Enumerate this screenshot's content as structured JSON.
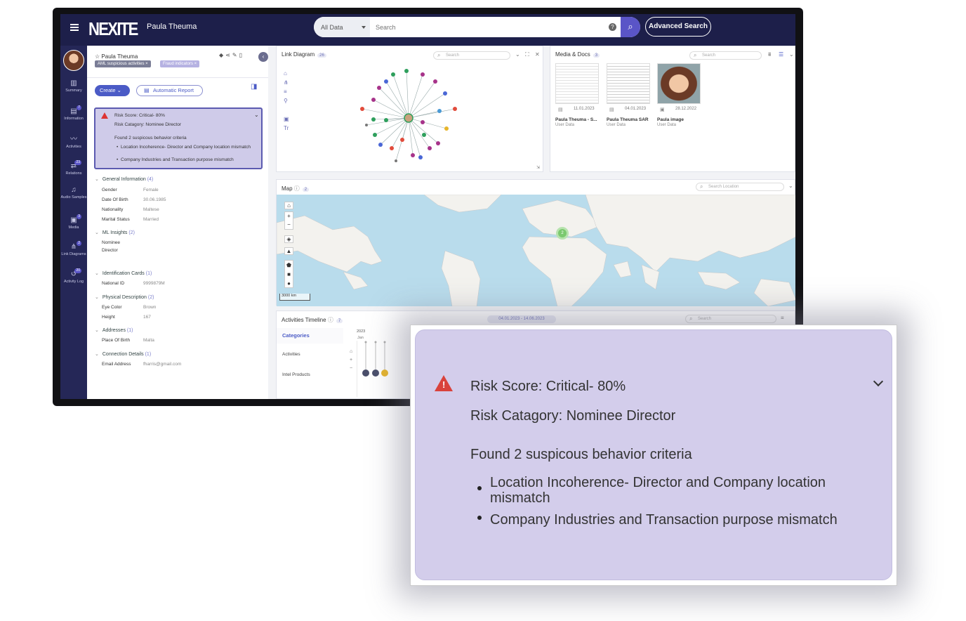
{
  "app": {
    "brand": "NEXITE",
    "user_name": "Paula Theuma"
  },
  "search": {
    "scope": "All Data",
    "placeholder": "Search",
    "advanced_label": "Advanced Search"
  },
  "nav": [
    {
      "label": "Summary",
      "icon": "chart-icon",
      "badge": ""
    },
    {
      "label": "Information",
      "icon": "info-icon",
      "badge": "7"
    },
    {
      "label": "Activities",
      "icon": "activity-icon",
      "badge": ""
    },
    {
      "label": "Relations",
      "icon": "relations-icon",
      "badge": "23"
    },
    {
      "label": "Audio Samples",
      "icon": "audio-icon",
      "badge": ""
    },
    {
      "label": "Media",
      "icon": "media-icon",
      "badge": "3"
    },
    {
      "label": "Link Diagrams",
      "icon": "diagram-icon",
      "badge": "2"
    },
    {
      "label": "Activity Log",
      "icon": "history-icon",
      "badge": "20"
    }
  ],
  "profile": {
    "name": "Paula Theuma",
    "tags": [
      "AML suspicious activities ×",
      "Fraud indicators ×"
    ],
    "create_label": "Create",
    "auto_report_label": "Automatic Report"
  },
  "risk": {
    "score": "Risk Score: Critical- 80%",
    "category": "Risk Catagory: Nominee Director",
    "found": "Found 2 suspicous behavior criteria",
    "criteria": [
      "Location Incoherence- Director and Company location mismatch",
      "Company Industries and Transaction purpose mismatch"
    ]
  },
  "sections": {
    "general": {
      "title": "General Information",
      "count": "(4)",
      "fields": [
        [
          "Gender",
          "Female"
        ],
        [
          "Date Of Birth",
          "30.06.1985"
        ],
        [
          "Nationality",
          "Maltese"
        ],
        [
          "Marital Status",
          "Married"
        ]
      ]
    },
    "ml": {
      "title": "ML Insights",
      "count": "(2)",
      "value1": "Nominee",
      "value2": "Director"
    },
    "idcards": {
      "title": "Identification Cards",
      "count": "(1)",
      "fields": [
        [
          "National ID",
          "9999879M"
        ]
      ]
    },
    "physical": {
      "title": "Physical Description",
      "count": "(2)",
      "fields": [
        [
          "Eye Color",
          "Brown"
        ],
        [
          "Height",
          "167"
        ]
      ]
    },
    "addresses": {
      "title": "Addresses",
      "count": "(1)",
      "fields": [
        [
          "Place Of Birth",
          "Malta"
        ]
      ]
    },
    "connection": {
      "title": "Connection Details",
      "count": "(1)",
      "fields": [
        [
          "Email Address",
          "fharris@gmail.com"
        ]
      ]
    }
  },
  "link_diagram": {
    "title": "Link Diagram",
    "count": "26",
    "search_placeholder": "Search"
  },
  "media": {
    "title": "Media & Docs",
    "count": "3",
    "search_placeholder": "Search",
    "items": [
      {
        "date": "11.01.2023",
        "name": "Paula Theuma - S...",
        "sub": "User Data"
      },
      {
        "date": "04.01.2023",
        "name": "Paula Theuma SAR",
        "sub": "User Data"
      },
      {
        "date": "28.12.2022",
        "name": "Paula image",
        "sub": "User Data"
      }
    ]
  },
  "map": {
    "title": "Map",
    "count": "2",
    "search_placeholder": "Search Location",
    "cluster": "2",
    "scale": "3000 km"
  },
  "timeline": {
    "title": "Activities Timeline",
    "count": "7",
    "date_range": "04.01.2023 - 14.06.2023",
    "search_placeholder": "Search",
    "categories_label": "Categories",
    "categories": [
      "Activities",
      "Intel Products"
    ],
    "year": "2023",
    "month": "Jan"
  },
  "colors": {
    "topbar": "#1d1f4a",
    "nav": "#252757",
    "accent": "#5a55c7",
    "risk_card": "#d3cdeb",
    "critical": "#d9423c",
    "map_water": "#b9dcec",
    "map_land": "#f3f2ee"
  }
}
